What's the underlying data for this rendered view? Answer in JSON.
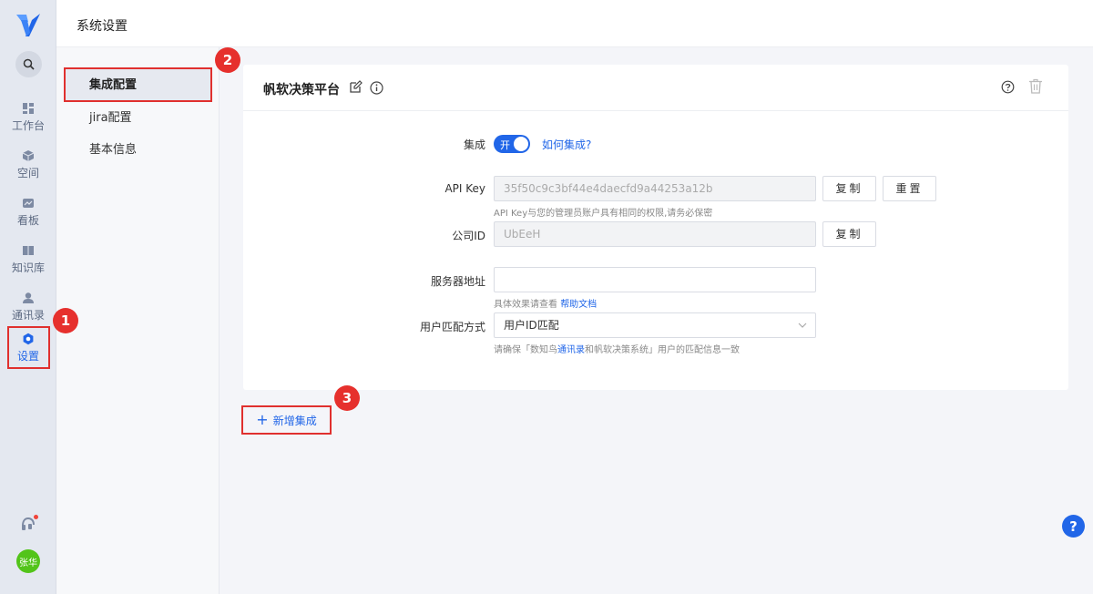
{
  "rail": {
    "items": [
      {
        "label": "工作台",
        "icon": "dashboard-icon"
      },
      {
        "label": "空间",
        "icon": "cube-icon"
      },
      {
        "label": "看板",
        "icon": "board-icon"
      },
      {
        "label": "知识库",
        "icon": "book-icon"
      },
      {
        "label": "通讯录",
        "icon": "contacts-icon"
      },
      {
        "label": "设置",
        "icon": "gear-icon"
      }
    ],
    "avatar": "张华"
  },
  "header": {
    "title": "系统设置"
  },
  "subnav": {
    "items": [
      "集成配置",
      "jira配置",
      "基本信息"
    ],
    "active": "集成配置"
  },
  "card": {
    "title": "帆软决策平台",
    "integration_label": "集成",
    "toggle_text": "开",
    "toggle_on": true,
    "how_link": "如何集成?",
    "api_key_label": "API Key",
    "api_key_value": "35f50c9c3bf44e4daecfd9a44253a12b",
    "api_key_hint": "API Key与您的管理员账户具有相同的权限,请务必保密",
    "copy_label": "复制",
    "reset_label": "重置",
    "company_id_label": "公司ID",
    "company_id_value": "UbEeH",
    "server_label": "服务器地址",
    "server_value": "",
    "server_hint_prefix": "具体效果请查看",
    "server_hint_link": "帮助文档",
    "match_label": "用户匹配方式",
    "match_value": "用户ID匹配",
    "match_hint_prefix": "请确保「数知鸟",
    "match_hint_link": "通讯录",
    "match_hint_suffix": "和帆软决策系统」用户的匹配信息一致"
  },
  "add_button": "新增集成",
  "markers": [
    "1",
    "2",
    "3"
  ],
  "float_help": "?",
  "colors": {
    "accent": "#2166e8",
    "highlight": "#e0302e",
    "marker": "#e6302d"
  }
}
